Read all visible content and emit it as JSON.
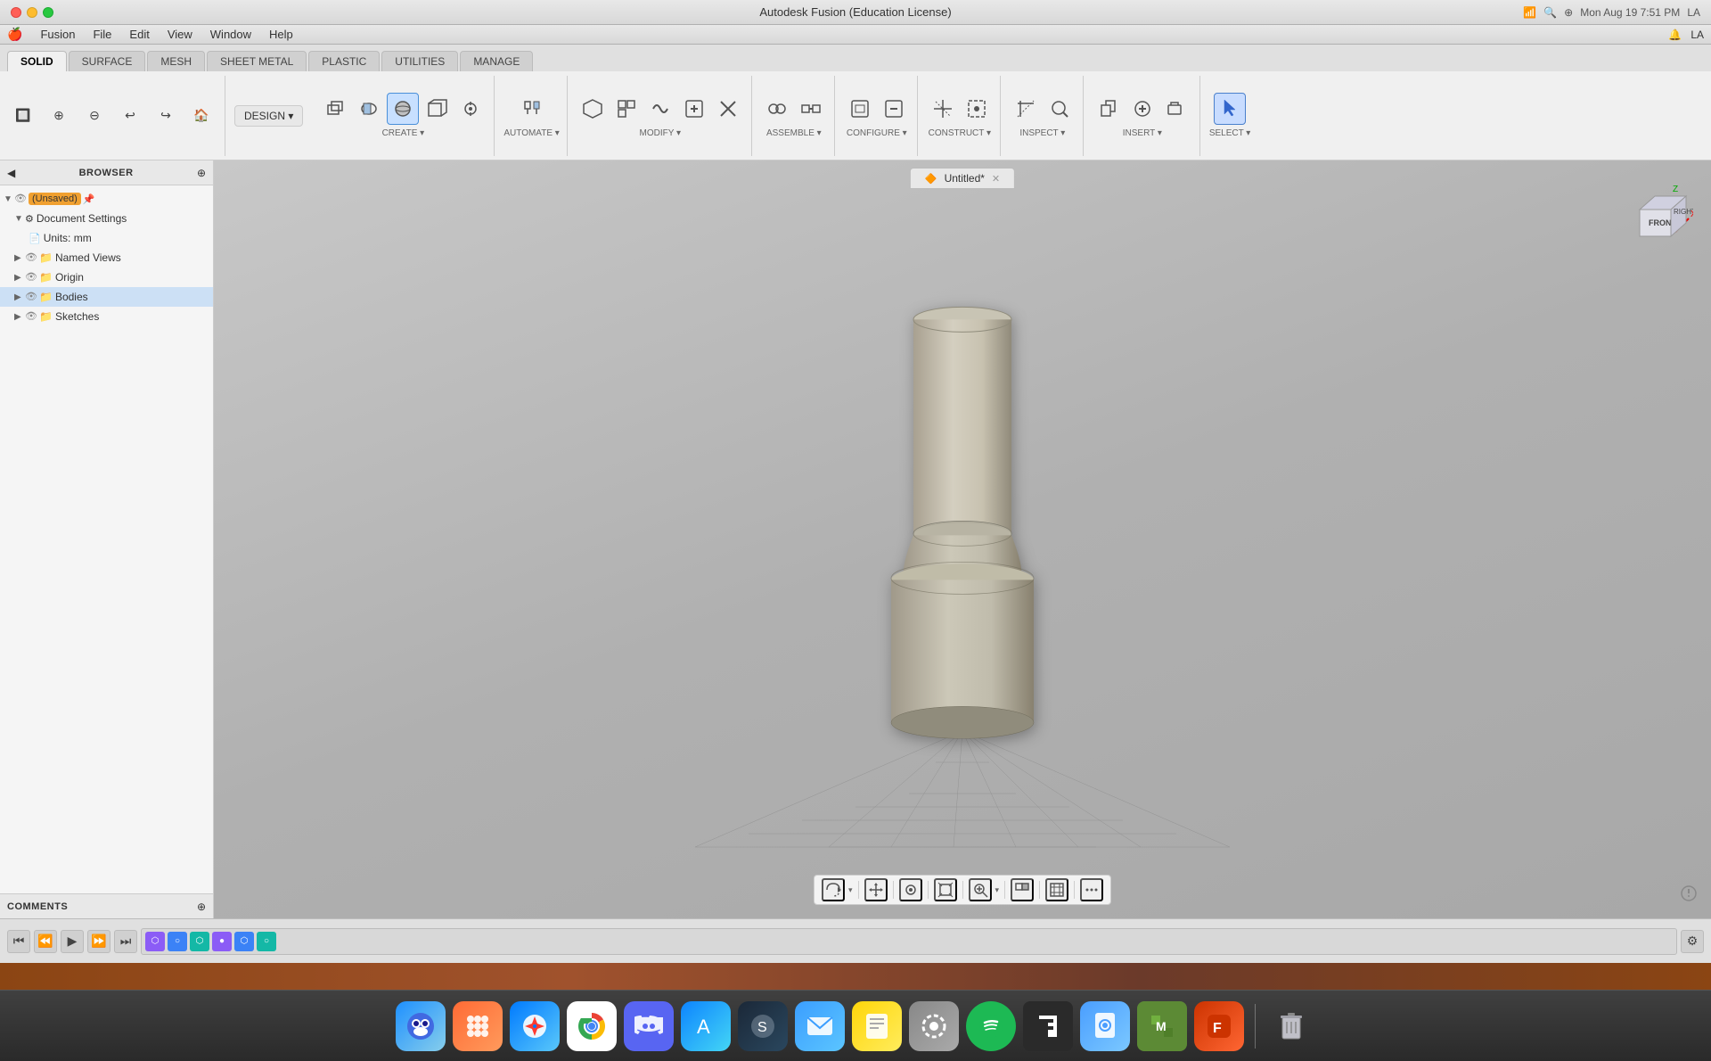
{
  "app": {
    "title": "Autodesk Fusion (Education License)",
    "document_title": "Untitled*"
  },
  "titlebar": {
    "datetime": "Mon Aug 19  7:51 PM"
  },
  "menubar": {
    "items": [
      "Fusion",
      "File",
      "Edit",
      "View",
      "Window",
      "Help"
    ]
  },
  "toolbar": {
    "tabs": [
      "SOLID",
      "SURFACE",
      "MESH",
      "SHEET METAL",
      "PLASTIC",
      "UTILITIES",
      "MANAGE"
    ],
    "active_tab": "SOLID",
    "design_label": "DESIGN ▾",
    "sections": [
      {
        "label": "CREATE ▾",
        "buttons": [
          {
            "icon": "⬜",
            "label": ""
          },
          {
            "icon": "◼",
            "label": ""
          },
          {
            "icon": "⭕",
            "label": ""
          },
          {
            "icon": "◧",
            "label": ""
          },
          {
            "icon": "✳",
            "label": ""
          }
        ]
      },
      {
        "label": "AUTOMATE ▾",
        "buttons": [
          {
            "icon": "⊕",
            "label": ""
          }
        ]
      },
      {
        "label": "MODIFY ▾",
        "buttons": [
          {
            "icon": "⬡",
            "label": ""
          },
          {
            "icon": "◫",
            "label": ""
          },
          {
            "icon": "⧈",
            "label": ""
          },
          {
            "icon": "⊞",
            "label": ""
          },
          {
            "icon": "✛",
            "label": ""
          }
        ]
      },
      {
        "label": "ASSEMBLE ▾",
        "buttons": [
          {
            "icon": "⊕",
            "label": ""
          },
          {
            "icon": "⊗",
            "label": ""
          }
        ]
      },
      {
        "label": "CONFIGURE ▾",
        "buttons": [
          {
            "icon": "⊡",
            "label": ""
          },
          {
            "icon": "⊟",
            "label": ""
          }
        ]
      },
      {
        "label": "CONSTRUCT ▾",
        "buttons": [
          {
            "icon": "⊘",
            "label": ""
          },
          {
            "icon": "⊕",
            "label": ""
          }
        ]
      },
      {
        "label": "INSPECT ▾",
        "buttons": [
          {
            "icon": "⊖",
            "label": ""
          },
          {
            "icon": "⊙",
            "label": ""
          }
        ]
      },
      {
        "label": "INSERT ▾",
        "buttons": [
          {
            "icon": "⊕",
            "label": ""
          },
          {
            "icon": "⊞",
            "label": ""
          },
          {
            "icon": "⊡",
            "label": ""
          }
        ]
      },
      {
        "label": "SELECT ▾",
        "buttons": [
          {
            "icon": "↖",
            "label": ""
          }
        ]
      }
    ]
  },
  "browser": {
    "title": "BROWSER",
    "items": [
      {
        "id": "unsaved",
        "label": "(Unsaved)",
        "indent": 0,
        "type": "root",
        "expanded": true
      },
      {
        "id": "doc-settings",
        "label": "Document Settings",
        "indent": 1,
        "type": "settings",
        "expanded": true
      },
      {
        "id": "units",
        "label": "Units: mm",
        "indent": 2,
        "type": "units"
      },
      {
        "id": "named-views",
        "label": "Named Views",
        "indent": 1,
        "type": "folder"
      },
      {
        "id": "origin",
        "label": "Origin",
        "indent": 1,
        "type": "folder"
      },
      {
        "id": "bodies",
        "label": "Bodies",
        "indent": 1,
        "type": "folder"
      },
      {
        "id": "sketches",
        "label": "Sketches",
        "indent": 1,
        "type": "folder"
      }
    ]
  },
  "comments": {
    "label": "COMMENTS"
  },
  "viewport_toolbar": {
    "buttons": [
      {
        "icon": "⊕",
        "name": "orbit"
      },
      {
        "icon": "✥",
        "name": "pan"
      },
      {
        "icon": "☞",
        "name": "look"
      },
      {
        "icon": "⊙",
        "name": "fit"
      },
      {
        "icon": "⊖",
        "name": "zoom"
      },
      {
        "icon": "◫",
        "name": "display-mode"
      },
      {
        "icon": "⊞",
        "name": "grid"
      },
      {
        "icon": "⋮⋮",
        "name": "more"
      }
    ]
  },
  "timeline": {
    "items": [
      {
        "type": "purple",
        "icon": "⬡"
      },
      {
        "type": "blue",
        "icon": "○"
      },
      {
        "type": "teal",
        "icon": "⬡"
      },
      {
        "type": "purple",
        "icon": "○"
      },
      {
        "type": "blue",
        "icon": "⬡"
      },
      {
        "type": "teal",
        "icon": "○"
      }
    ]
  },
  "dock": {
    "items": [
      {
        "name": "finder",
        "color": "#1e90ff",
        "icon": "🔍"
      },
      {
        "name": "launchpad",
        "color": "#ff6b35",
        "icon": "⚙"
      },
      {
        "name": "safari",
        "color": "#0099ff",
        "icon": "🧭"
      },
      {
        "name": "chrome",
        "color": "#4285f4",
        "icon": "●"
      },
      {
        "name": "discord",
        "color": "#5865f2",
        "icon": "💬"
      },
      {
        "name": "app-store",
        "color": "#0d84ff",
        "icon": "A"
      },
      {
        "name": "steam",
        "color": "#1b2838",
        "icon": "S"
      },
      {
        "name": "mail",
        "color": "#3b9eff",
        "icon": "✉"
      },
      {
        "name": "notes",
        "color": "#ffd60a",
        "icon": "📝"
      },
      {
        "name": "system-prefs",
        "color": "#888",
        "icon": "⚙"
      },
      {
        "name": "spotify",
        "color": "#1db954",
        "icon": "♫"
      },
      {
        "name": "epic-games",
        "color": "#333",
        "icon": "E"
      },
      {
        "name": "preview",
        "color": "#4a9eff",
        "icon": "👁"
      },
      {
        "name": "minecraft",
        "color": "#5c8a35",
        "icon": "M"
      },
      {
        "name": "fusion",
        "color": "#cc3300",
        "icon": "F"
      },
      {
        "name": "trash",
        "color": "#888",
        "icon": "🗑"
      }
    ]
  }
}
